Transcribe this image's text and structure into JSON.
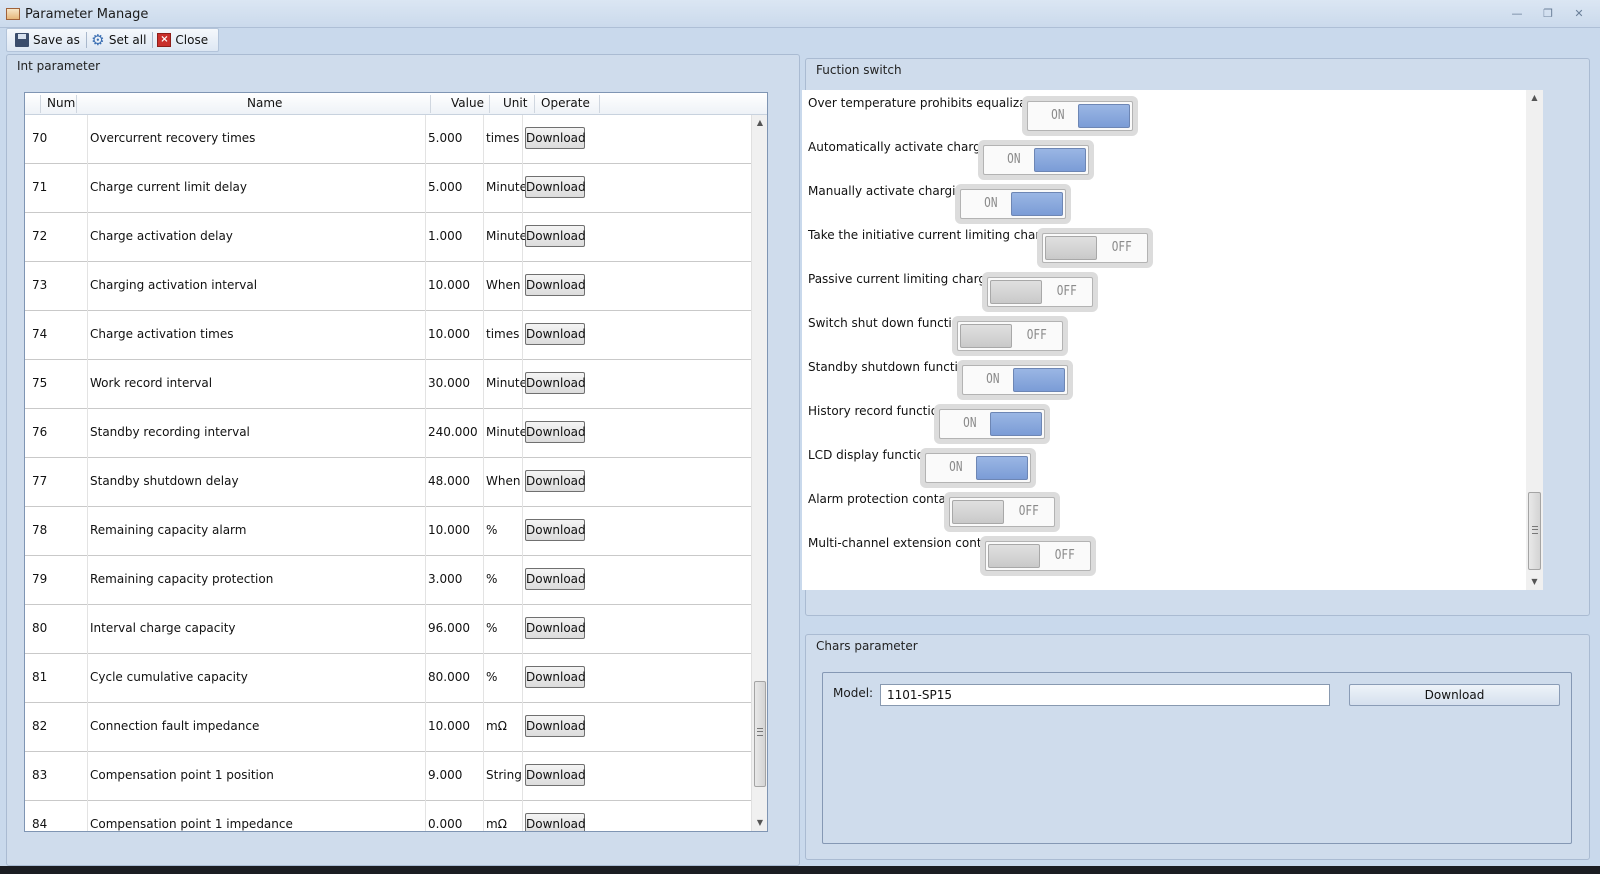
{
  "window": {
    "title": "Parameter Manage"
  },
  "toolbar": {
    "save_as": "Save as",
    "set_all": "Set all",
    "close": "Close"
  },
  "int_panel": {
    "title": "Int parameter",
    "columns": {
      "num": "Num",
      "name": "Name",
      "value": "Value",
      "unit": "Unit",
      "operate": "Operate"
    },
    "rows": [
      {
        "num": "70",
        "name": "Overcurrent recovery times",
        "value": "5.000",
        "unit": "times",
        "action": "Download"
      },
      {
        "num": "71",
        "name": "Charge current limit delay",
        "value": "5.000",
        "unit": "Minute",
        "action": "Download"
      },
      {
        "num": "72",
        "name": "Charge activation delay",
        "value": "1.000",
        "unit": "Minute",
        "action": "Download"
      },
      {
        "num": "73",
        "name": "Charging activation interval",
        "value": "10.000",
        "unit": "When",
        "action": "Download"
      },
      {
        "num": "74",
        "name": "Charge activation times",
        "value": "10.000",
        "unit": "times",
        "action": "Download"
      },
      {
        "num": "75",
        "name": "Work record interval",
        "value": "30.000",
        "unit": "Minute",
        "action": "Download"
      },
      {
        "num": "76",
        "name": "Standby recording interval",
        "value": "240.000",
        "unit": "Minute",
        "action": "Download"
      },
      {
        "num": "77",
        "name": "Standby shutdown delay",
        "value": "48.000",
        "unit": "When",
        "action": "Download"
      },
      {
        "num": "78",
        "name": "Remaining capacity alarm",
        "value": "10.000",
        "unit": "%",
        "action": "Download"
      },
      {
        "num": "79",
        "name": "Remaining capacity protection",
        "value": "3.000",
        "unit": "%",
        "action": "Download"
      },
      {
        "num": "80",
        "name": "Interval charge capacity",
        "value": "96.000",
        "unit": "%",
        "action": "Download"
      },
      {
        "num": "81",
        "name": "Cycle cumulative capacity",
        "value": "80.000",
        "unit": "%",
        "action": "Download"
      },
      {
        "num": "82",
        "name": "Connection fault impedance",
        "value": "10.000",
        "unit": "mΩ",
        "action": "Download"
      },
      {
        "num": "83",
        "name": "Compensation point 1 position",
        "value": "9.000",
        "unit": "String",
        "action": "Download"
      },
      {
        "num": "84",
        "name": "Compensation point 1 impedance",
        "value": "0.000",
        "unit": "mΩ",
        "action": "Download"
      }
    ]
  },
  "switch_panel": {
    "title": "Fuction switch",
    "on_text": "ON",
    "off_text": "OFF",
    "items": [
      {
        "label": "Over temperature prohibits equalization",
        "state": "on"
      },
      {
        "label": "Automatically activate charging",
        "state": "on"
      },
      {
        "label": "Manually activate charging",
        "state": "on"
      },
      {
        "label": "Take the initiative current limiting charging",
        "state": "off"
      },
      {
        "label": "Passive current limiting charging",
        "state": "off"
      },
      {
        "label": "Switch shut down function",
        "state": "off"
      },
      {
        "label": "Standby shutdown function",
        "state": "on"
      },
      {
        "label": "History record function",
        "state": "on"
      },
      {
        "label": "LCD display function",
        "state": "on"
      },
      {
        "label": "Alarm protection contact",
        "state": "off"
      },
      {
        "label": "Multi-channel extension contact",
        "state": "off"
      }
    ]
  },
  "chars_panel": {
    "title": "Chars parameter",
    "model_label": "Model:",
    "model_value": "1101-SP15",
    "download": "Download"
  },
  "colors": {
    "toggle_on": "#8aa9dd",
    "toggle_off": "#d2d2d2",
    "background": "#c9d9ec"
  }
}
